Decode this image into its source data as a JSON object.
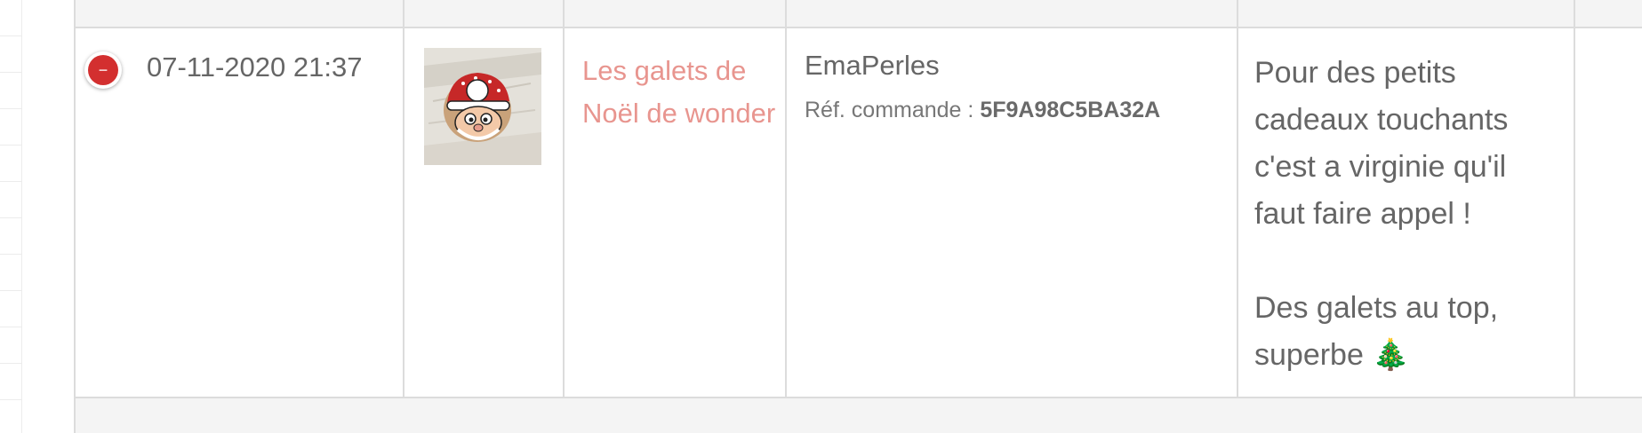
{
  "row": {
    "status": {
      "icon": "minus-icon",
      "symbol": "−",
      "color": "#d32f2f"
    },
    "date": "07-11-2020 21:37",
    "product": {
      "image_icon": "santa-pebble-thumbnail",
      "name": "Les galets de Noël de wonder",
      "color": "#e8958f"
    },
    "seller": {
      "name": "EmaPerles",
      "ref_label": "Réf. commande :",
      "ref_value": "5F9A98C5BA32A"
    },
    "comment": {
      "line1": "Pour des petits cadeaux touchants c'est a virginie qu'il faut faire appel !",
      "line2": "Des galets au top, superbe 🎄"
    }
  }
}
